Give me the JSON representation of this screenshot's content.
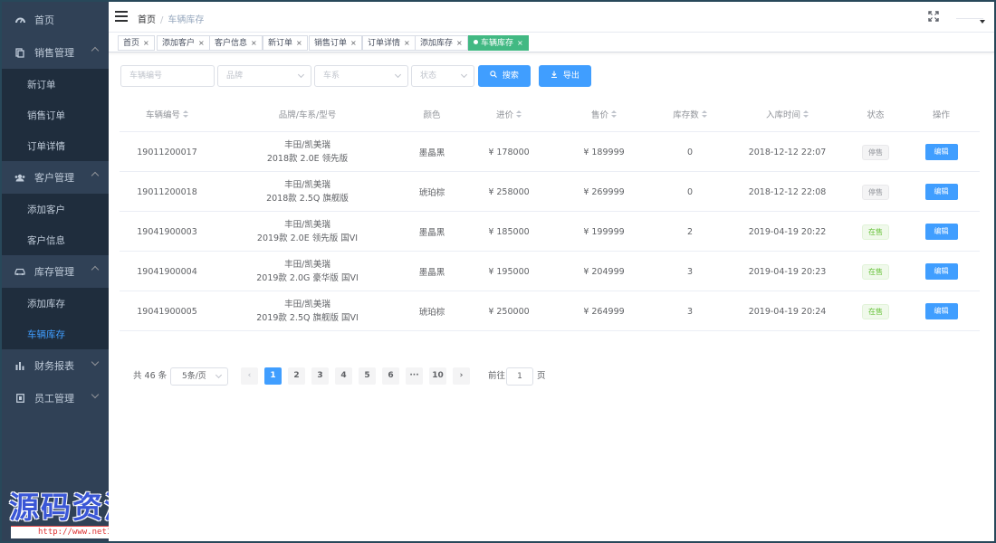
{
  "sidebar": {
    "items": [
      {
        "label": "首页",
        "icon": "dashboard-icon"
      },
      {
        "label": "销售管理",
        "icon": "document-icon",
        "expanded": true,
        "children": [
          {
            "label": "新订单"
          },
          {
            "label": "销售订单"
          },
          {
            "label": "订单详情"
          }
        ]
      },
      {
        "label": "客户管理",
        "icon": "users-icon",
        "expanded": true,
        "children": [
          {
            "label": "添加客户"
          },
          {
            "label": "客户信息"
          }
        ]
      },
      {
        "label": "库存管理",
        "icon": "car-icon",
        "expanded": true,
        "children": [
          {
            "label": "添加库存"
          },
          {
            "label": "车辆库存",
            "active": true
          }
        ]
      },
      {
        "label": "财务报表",
        "icon": "chart-icon",
        "expanded": false
      },
      {
        "label": "员工管理",
        "icon": "user-icon",
        "expanded": false
      }
    ]
  },
  "watermark": {
    "text": "源码资源网",
    "url": "http://www.net188.com"
  },
  "navbar": {
    "breadcrumb_home": "首页",
    "breadcrumb_sep": "/",
    "breadcrumb_current": "车辆库存"
  },
  "tags": [
    {
      "label": "首页"
    },
    {
      "label": "添加客户"
    },
    {
      "label": "客户信息"
    },
    {
      "label": "新订单"
    },
    {
      "label": "销售订单"
    },
    {
      "label": "订单详情"
    },
    {
      "label": "添加库存"
    },
    {
      "label": "车辆库存",
      "active": true
    }
  ],
  "tag_close": "×",
  "filters": {
    "vehicle_no_placeholder": "车辆编号",
    "brand_placeholder": "品牌",
    "series_placeholder": "车系",
    "status_placeholder": "状态",
    "search_label": "搜索",
    "export_label": "导出"
  },
  "table": {
    "headers": [
      "车辆编号",
      "品牌/车系/型号",
      "颜色",
      "进价",
      "售价",
      "库存数",
      "入库时间",
      "状态",
      "操作"
    ],
    "rows": [
      {
        "no": "19011200017",
        "model1": "丰田/凯美瑞",
        "model2": "2018款 2.0E 领先版",
        "color": "墨晶黑",
        "cost": "¥ 178000",
        "price": "¥ 189999",
        "stock": "0",
        "time": "2018-12-12 22:07",
        "status": "停售",
        "status_type": "stop",
        "action": "编辑"
      },
      {
        "no": "19011200018",
        "model1": "丰田/凯美瑞",
        "model2": "2018款 2.5Q 旗舰版",
        "color": "琥珀棕",
        "cost": "¥ 258000",
        "price": "¥ 269999",
        "stock": "0",
        "time": "2018-12-12 22:08",
        "status": "停售",
        "status_type": "stop",
        "action": "编辑"
      },
      {
        "no": "19041900003",
        "model1": "丰田/凯美瑞",
        "model2": "2019款 2.0E 领先版 国VI",
        "color": "墨晶黑",
        "cost": "¥ 185000",
        "price": "¥ 199999",
        "stock": "2",
        "time": "2019-04-19 20:22",
        "status": "在售",
        "status_type": "on",
        "action": "编辑"
      },
      {
        "no": "19041900004",
        "model1": "丰田/凯美瑞",
        "model2": "2019款 2.0G 豪华版 国VI",
        "color": "墨晶黑",
        "cost": "¥ 195000",
        "price": "¥ 204999",
        "stock": "3",
        "time": "2019-04-19 20:23",
        "status": "在售",
        "status_type": "on",
        "action": "编辑"
      },
      {
        "no": "19041900005",
        "model1": "丰田/凯美瑞",
        "model2": "2019款 2.5Q 旗舰版 国VI",
        "color": "琥珀棕",
        "cost": "¥ 250000",
        "price": "¥ 264999",
        "stock": "3",
        "time": "2019-04-19 20:24",
        "status": "在售",
        "status_type": "on",
        "action": "编辑"
      }
    ]
  },
  "pagination": {
    "total": "共 46 条",
    "page_size": "5条/页",
    "prev": "‹",
    "next": "›",
    "pages": [
      "1",
      "2",
      "3",
      "4",
      "5",
      "6",
      "···",
      "10"
    ],
    "current": "1",
    "goto_label": "前往",
    "goto_value": "1",
    "page_unit": "页"
  },
  "colors": {
    "primary": "#409eff",
    "sidebar_bg": "#304156",
    "submenu_bg": "#1f2d3d",
    "active_tag": "#42b983",
    "success": "#67c23a"
  }
}
